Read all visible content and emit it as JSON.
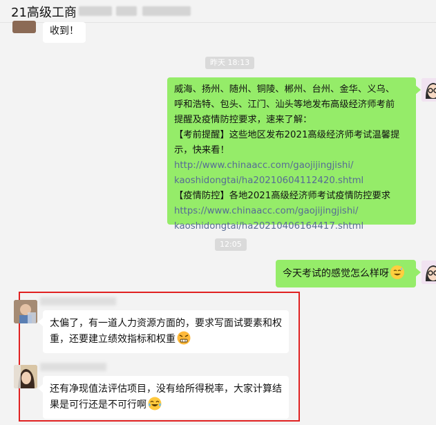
{
  "header": {
    "title": "21高级工商"
  },
  "messages": {
    "m0": {
      "text": "收到！"
    },
    "ts1": "昨天 18:13",
    "m1": {
      "lines": [
        "威海、扬州、随州、铜陵、郴州、台州、金华、义乌、",
        "呼和浩特、包头、江门、汕头等地发布高级经济师考前",
        "提醒及疫情防控要求，速来了解：",
        "【考前提醒】这些地区发布2021高级经济师考试温馨提",
        "示，快来看！",
        "http://www.chinaacc.com/gaojijingjishi/",
        "kaoshidongtai/ha20210604112420.shtml",
        "【疫情防控】各地2021高级经济师考试疫情防控要求",
        "https://www.chinaacc.com/gaojijingjishi/",
        "kaoshidongtai/ha20210406164417.shtml"
      ]
    },
    "ts2": "12:05",
    "m2": {
      "text": "今天考试的感觉怎么样呀"
    },
    "m3": {
      "line1": "太偏了，有一道人力资源方面的，要求写面试要素和权",
      "line2": "重，还要建立绩效指标和权重"
    },
    "m4": {
      "line1": "还有净现值法评估项目，没有给所得税率，大家计算结",
      "line2": "果是可行还是不可行啊"
    }
  },
  "icons": {
    "emoji_smile": "face-sweat-smile",
    "emoji_angry": "face-angry",
    "emoji_cry": "face-crying-laugh"
  },
  "colors": {
    "my_bubble": "#95ec69",
    "their_bubble": "#ffffff",
    "link": "#576b95",
    "highlight_box": "#e02020"
  }
}
